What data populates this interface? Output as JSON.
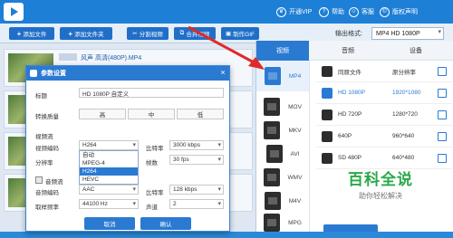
{
  "titlebar": {
    "items": [
      {
        "icon": "crown-icon",
        "label": "开通VIP"
      },
      {
        "icon": "help-icon",
        "label": "帮助"
      },
      {
        "icon": "support-icon",
        "label": "客服"
      },
      {
        "icon": "copyright-icon",
        "label": "版权声明"
      }
    ]
  },
  "toolbar": {
    "buttons": [
      "添加文件",
      "添加文件夹",
      "分割视频",
      "合并视频",
      "制作GIF"
    ],
    "output_label": "输出格式:",
    "output_value": "MP4 HD 1080P"
  },
  "files": [
    {
      "name": "风声 高清(480P).MP4"
    },
    {
      "name": ""
    }
  ],
  "dialog": {
    "title": "参数设置",
    "fields": {
      "title_label": "标题",
      "title_value": "HD 1080P 自定义",
      "quality_label": "转换质量",
      "quality_options": [
        "高",
        "中",
        "低"
      ],
      "video_section": "视频流",
      "video_codec_label": "视频编码",
      "video_codec_value": "H264",
      "codec_options": [
        "自动",
        "MPEG-4",
        "H264",
        "HEVC"
      ],
      "codec_selected_index": 2,
      "resolution_label": "分辨率",
      "bitrate_label": "比特率",
      "bitrate_value": "3000 kbps",
      "fps_label": "帧数",
      "fps_value": "30 fps",
      "audio_section": "音频流",
      "audio_codec_label": "音频编码",
      "audio_codec_value": "AAC",
      "audio_bitrate_label": "比特率",
      "audio_bitrate_value": "128 kbps",
      "sample_rate_label": "取样频率",
      "sample_rate_value": "44100 Hz",
      "channel_label": "声道",
      "channel_value": "2"
    },
    "cancel_label": "取消",
    "ok_label": "确认"
  },
  "panel": {
    "tabs": [
      "视频",
      "音频",
      "设备"
    ],
    "active_tab_index": 0,
    "formats": [
      "MP4",
      "MOV",
      "MKV",
      "AVI",
      "WMV",
      "M4V",
      "MPG"
    ],
    "active_format_index": 0,
    "resolutions": [
      {
        "name": "同原文件",
        "value": "原分辨率",
        "active": false
      },
      {
        "name": "HD 1080P",
        "value": "1920*1080",
        "active": true
      },
      {
        "name": "HD 720P",
        "value": "1280*720",
        "active": false
      },
      {
        "name": "640P",
        "value": "960*640",
        "active": false
      },
      {
        "name": "SD 480P",
        "value": "640*480",
        "active": false
      }
    ]
  },
  "watermark": {
    "title": "百科全说",
    "subtitle": "助你轻松解决"
  },
  "colors": {
    "brand": "#1e7fd6",
    "accent": "#2b7ad2",
    "arrow": "#e02a2a"
  }
}
